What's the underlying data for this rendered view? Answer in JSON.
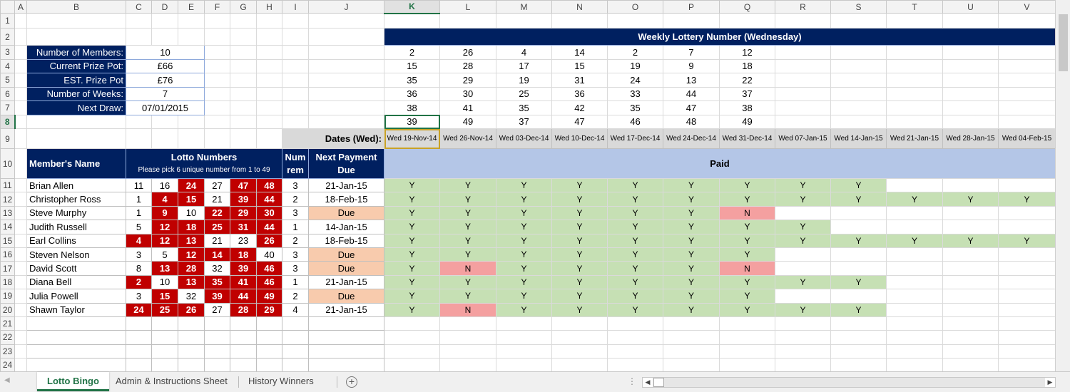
{
  "columns": [
    "A",
    "B",
    "C",
    "D",
    "E",
    "F",
    "G",
    "H",
    "I",
    "J",
    "K",
    "L",
    "M",
    "N",
    "O",
    "P",
    "Q",
    "R",
    "S",
    "T",
    "U",
    "V"
  ],
  "selected_cell": "K8",
  "summary": [
    {
      "label": "Number of Members:",
      "value": "10"
    },
    {
      "label": "Current Prize Pot:",
      "value": "£66"
    },
    {
      "label": "EST. Prize Pot",
      "value": "£76"
    },
    {
      "label": "Number of Weeks:",
      "value": "7"
    },
    {
      "label": "Next Draw:",
      "value": "07/01/2015"
    }
  ],
  "weekly": {
    "title": "Weekly Lottery Number (Wednesday)",
    "draws": [
      [
        2,
        15,
        35,
        36,
        38,
        39
      ],
      [
        26,
        28,
        29,
        30,
        41,
        49
      ],
      [
        4,
        17,
        19,
        25,
        35,
        37
      ],
      [
        14,
        15,
        31,
        36,
        42,
        47
      ],
      [
        2,
        19,
        24,
        33,
        35,
        46
      ],
      [
        7,
        9,
        13,
        44,
        47,
        48
      ],
      [
        12,
        18,
        22,
        37,
        38,
        49
      ]
    ]
  },
  "dates_label": "Dates (Wed):",
  "dates": [
    "Wed 19-Nov-14",
    "Wed 26-Nov-14",
    "Wed 03-Dec-14",
    "Wed 10-Dec-14",
    "Wed 17-Dec-14",
    "Wed 24-Dec-14",
    "Wed 31-Dec-14",
    "Wed 07-Jan-15",
    "Wed 14-Jan-15",
    "Wed 21-Jan-15",
    "Wed 28-Jan-15",
    "Wed 04-Feb-15"
  ],
  "headers": {
    "member": "Member's Name",
    "lotto": "Lotto Numbers",
    "lotto_sub": "Please pick 6 unique number from 1 to 49",
    "num_rem": "Num\nrem",
    "next_payment": "Next Payment\nDue",
    "paid": "Paid"
  },
  "members": [
    {
      "name": "Brian Allen",
      "numbers": [
        11,
        16,
        24,
        27,
        47,
        48
      ],
      "rem": "3",
      "next_due": "21-Jan-15",
      "paid": [
        "Y",
        "Y",
        "Y",
        "Y",
        "Y",
        "Y",
        "Y",
        "Y",
        "Y",
        "",
        "",
        ""
      ]
    },
    {
      "name": "Christopher Ross",
      "numbers": [
        1,
        4,
        15,
        21,
        39,
        44
      ],
      "rem": "2",
      "next_due": "18-Feb-15",
      "paid": [
        "Y",
        "Y",
        "Y",
        "Y",
        "Y",
        "Y",
        "Y",
        "Y",
        "Y",
        "Y",
        "Y",
        "Y"
      ]
    },
    {
      "name": "Steve Murphy",
      "numbers": [
        1,
        9,
        10,
        22,
        29,
        30
      ],
      "rem": "3",
      "next_due": "Due",
      "paid": [
        "Y",
        "Y",
        "Y",
        "Y",
        "Y",
        "Y",
        "N",
        "",
        "",
        "",
        "",
        ""
      ]
    },
    {
      "name": "Judith Russell",
      "numbers": [
        5,
        12,
        18,
        25,
        31,
        44
      ],
      "rem": "1",
      "next_due": "14-Jan-15",
      "paid": [
        "Y",
        "Y",
        "Y",
        "Y",
        "Y",
        "Y",
        "Y",
        "Y",
        "",
        "",
        "",
        ""
      ]
    },
    {
      "name": "Earl Collins",
      "numbers": [
        4,
        12,
        13,
        21,
        23,
        26
      ],
      "rem": "2",
      "next_due": "18-Feb-15",
      "paid": [
        "Y",
        "Y",
        "Y",
        "Y",
        "Y",
        "Y",
        "Y",
        "Y",
        "Y",
        "Y",
        "Y",
        "Y"
      ]
    },
    {
      "name": "Steven Nelson",
      "numbers": [
        3,
        5,
        12,
        14,
        18,
        40
      ],
      "rem": "3",
      "next_due": "Due",
      "paid": [
        "Y",
        "Y",
        "Y",
        "Y",
        "Y",
        "Y",
        "Y",
        "",
        "",
        "",
        "",
        ""
      ]
    },
    {
      "name": "David Scott",
      "numbers": [
        8,
        13,
        28,
        32,
        39,
        46
      ],
      "rem": "3",
      "next_due": "Due",
      "paid": [
        "Y",
        "N",
        "Y",
        "Y",
        "Y",
        "Y",
        "N",
        "",
        "",
        "",
        "",
        ""
      ]
    },
    {
      "name": "Diana Bell",
      "numbers": [
        2,
        10,
        13,
        35,
        41,
        46
      ],
      "rem": "1",
      "next_due": "21-Jan-15",
      "paid": [
        "Y",
        "Y",
        "Y",
        "Y",
        "Y",
        "Y",
        "Y",
        "Y",
        "Y",
        "",
        "",
        ""
      ]
    },
    {
      "name": "Julia Powell",
      "numbers": [
        3,
        15,
        32,
        39,
        44,
        49
      ],
      "rem": "2",
      "next_due": "Due",
      "paid": [
        "Y",
        "Y",
        "Y",
        "Y",
        "Y",
        "Y",
        "Y",
        "",
        "",
        "",
        "",
        ""
      ]
    },
    {
      "name": "Shawn Taylor",
      "numbers": [
        24,
        25,
        26,
        27,
        28,
        29
      ],
      "rem": "4",
      "next_due": "21-Jan-15",
      "paid": [
        "Y",
        "N",
        "Y",
        "Y",
        "Y",
        "Y",
        "Y",
        "Y",
        "Y",
        "",
        "",
        ""
      ]
    }
  ],
  "tabs": [
    {
      "label": "Lotto Bingo",
      "active": true
    },
    {
      "label": "Admin & Instructions Sheet"
    },
    {
      "label": "History Winners"
    }
  ],
  "colors": {
    "navy": "#002060",
    "hit": "#c00000",
    "paid_yes": "#c6e0b4",
    "paid_no": "#f4a0a0",
    "due": "#f8cbad",
    "paid_header": "#b4c6e7",
    "accent": "#217346"
  }
}
